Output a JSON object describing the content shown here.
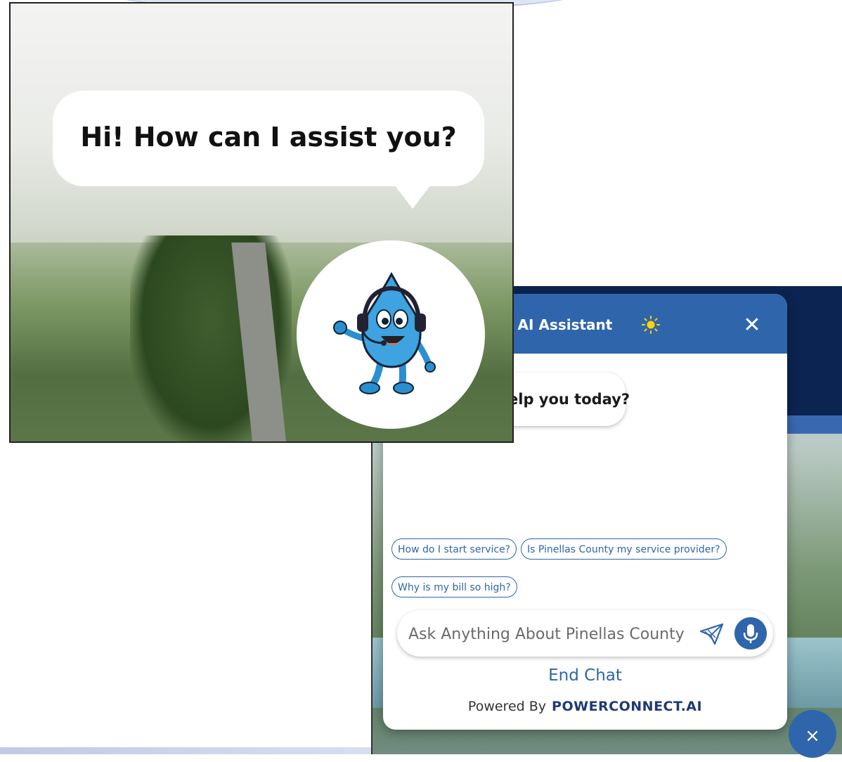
{
  "left_panel": {
    "speech_text": "Hi! How can I assist you?",
    "avatar_icon": "water-drop-mascot-icon"
  },
  "chat": {
    "title": "ual AI Assistant",
    "greeting": "elp you today?",
    "suggestions": [
      "How do I start service?",
      "Is Pinellas County my service provider?",
      "Why is my bill so high?"
    ],
    "input_placeholder": "Ask Anything About Pinellas County Utili",
    "end_chat_label": "End Chat",
    "powered_by": "Powered By",
    "brand": "POWERCONNECT.AI",
    "close_glyph": "✕",
    "fab_close_glyph": "×"
  },
  "colors": {
    "accent": "#2f65ab",
    "navy": "#0b2451"
  }
}
